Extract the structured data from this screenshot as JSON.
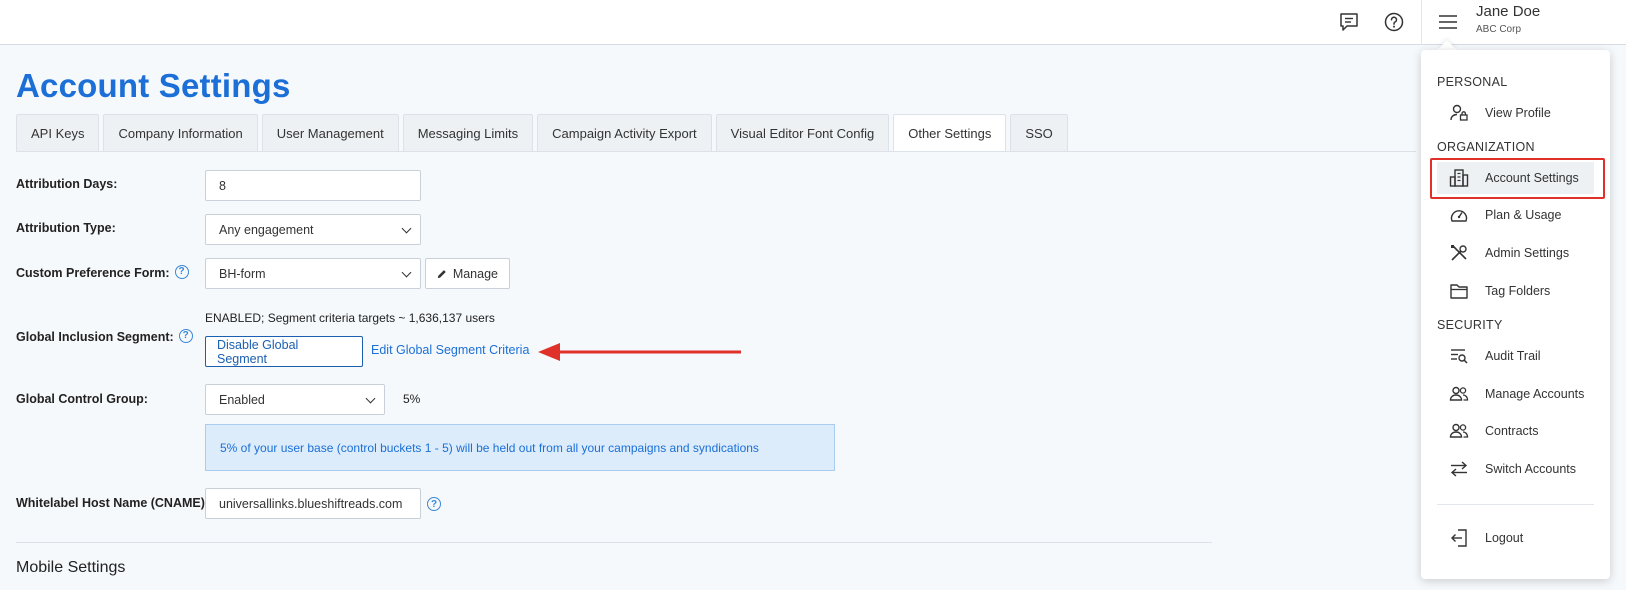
{
  "header": {
    "user_name": "Jane Doe",
    "user_org": "ABC Corp"
  },
  "page": {
    "title": "Account Settings"
  },
  "tabs": [
    {
      "label": "API Keys"
    },
    {
      "label": "Company Information"
    },
    {
      "label": "User Management"
    },
    {
      "label": "Messaging Limits"
    },
    {
      "label": "Campaign Activity Export"
    },
    {
      "label": "Visual Editor Font Config"
    },
    {
      "label": "Other Settings",
      "active": true
    },
    {
      "label": "SSO"
    }
  ],
  "form": {
    "attribution_days": {
      "label": "Attribution Days:",
      "value": "8"
    },
    "attribution_type": {
      "label": "Attribution Type:",
      "value": "Any engagement"
    },
    "custom_pref_form": {
      "label": "Custom Preference Form:",
      "value": "BH-form",
      "manage_label": "Manage"
    },
    "global_inclusion": {
      "label": "Global Inclusion Segment:",
      "status": "ENABLED; Segment criteria targets ~ 1,636,137 users",
      "disable_label": "Disable Global Segment",
      "edit_label": "Edit Global Segment Criteria"
    },
    "global_control": {
      "label": "Global Control Group:",
      "value": "Enabled",
      "percent": "5%",
      "info": "5% of your user base (control buckets 1 - 5) will be held out from all your campaigns and syndications"
    },
    "whitelabel": {
      "label": "Whitelabel Host Name (CNAME):",
      "value": "universallinks.blueshiftreads.com"
    }
  },
  "mobile_settings": {
    "title": "Mobile Settings"
  },
  "menu": {
    "personal_head": "PERSONAL",
    "org_head": "ORGANIZATION",
    "security_head": "SECURITY",
    "items": {
      "view_profile": "View Profile",
      "account_settings": "Account Settings",
      "plan_usage": "Plan & Usage",
      "admin_settings": "Admin Settings",
      "tag_folders": "Tag Folders",
      "audit_trail": "Audit Trail",
      "manage_accounts": "Manage Accounts",
      "contracts": "Contracts",
      "switch_accounts": "Switch Accounts",
      "logout": "Logout"
    }
  },
  "colors": {
    "accent": "#1b6fd6",
    "annotation": "#e0302a"
  }
}
